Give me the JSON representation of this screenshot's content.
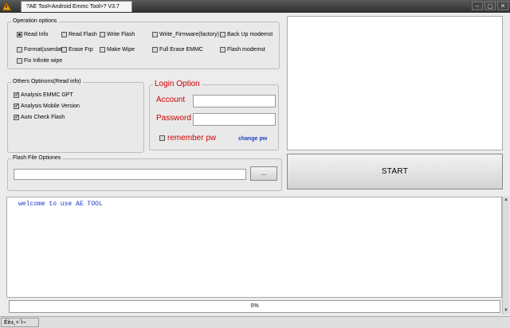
{
  "window": {
    "tab_title": "?AE Tool<Android Emmc Tool>? V3.7",
    "minimize_glyph": "–",
    "maximize_glyph": "▢",
    "close_glyph": "✕"
  },
  "operation_options": {
    "legend": "Operation options",
    "items": [
      {
        "label": "Read Info",
        "selected": true
      },
      {
        "label": "Read Flash",
        "selected": false
      },
      {
        "label": "Write Flash",
        "selected": false
      },
      {
        "label": "Write_Firmware(factory)",
        "selected": false
      },
      {
        "label": "Back Up modemst",
        "selected": false
      },
      {
        "label": "Format(userdata)",
        "selected": false
      },
      {
        "label": "Erase Frp",
        "selected": false
      },
      {
        "label": "Make Wipe",
        "selected": false
      },
      {
        "label": "Full Erase EMMC",
        "selected": false
      },
      {
        "label": "Flash modemst",
        "selected": false
      },
      {
        "label": "Fix Infinite wipe",
        "selected": false
      }
    ]
  },
  "other_options": {
    "legend": "Others Optinons(Read info)",
    "items": [
      {
        "label": "Analysis EMMC GPT",
        "checked": true
      },
      {
        "label": "Analysis Mobile Version",
        "checked": true
      },
      {
        "label": "Auto Check Flash",
        "checked": true
      }
    ]
  },
  "login": {
    "legend": "Login Option",
    "account_label": "Account",
    "password_label": "Password",
    "account_value": "",
    "password_value": "",
    "remember_label": "remember pw",
    "remember_checked": false,
    "change_pw_label": "change pw"
  },
  "flash_file": {
    "legend": "Flash File Optiones",
    "path_value": "",
    "browse_label": "..."
  },
  "start_label": "START",
  "log": {
    "lines": [
      "welcome to use AE TOOL"
    ]
  },
  "progress": {
    "value_percent": 0,
    "text": "0%"
  },
  "status": {
    "text": "Éè±¸×´Ì¬"
  },
  "colors": {
    "accent_red": "#cc0000",
    "link_blue": "#1c3fb8",
    "log_blue": "#1a35c9"
  }
}
